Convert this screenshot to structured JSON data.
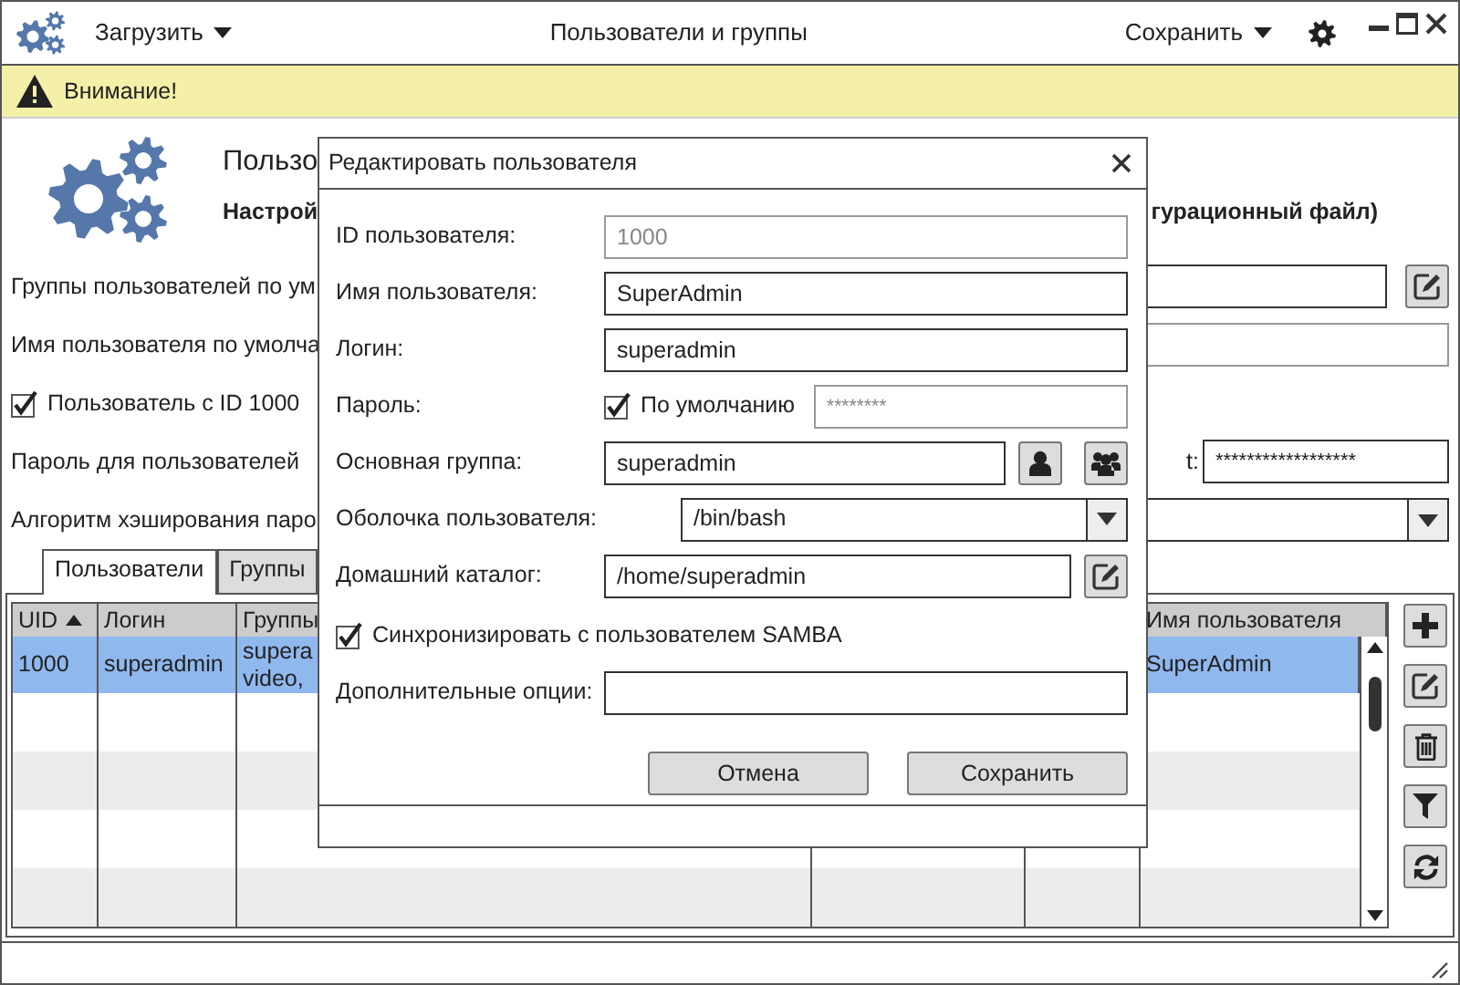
{
  "title_bar": {
    "load_menu": "Загрузить",
    "title": "Пользователи и группы",
    "save_menu": "Сохранить"
  },
  "alert": {
    "text": "Внимание!"
  },
  "header": {
    "heading": "Пользо",
    "subheading_left": "Настрой",
    "subheading_right": "гурационный файл)"
  },
  "settings": [
    {
      "kind": "field_button",
      "label": "Группы пользователей по ум",
      "disabled": false
    },
    {
      "kind": "field",
      "label": "Имя пользователя по умолча",
      "disabled": true
    },
    {
      "kind": "checkbox",
      "label": "Пользователь с ID 1000",
      "checked": true
    },
    {
      "kind": "password",
      "label": "Пароль для пользователей",
      "right_label": "t:",
      "value": "******************"
    },
    {
      "kind": "select",
      "label": "Алгоритм хэширования паро"
    }
  ],
  "tabs": [
    {
      "label": "Пользователи",
      "selected": true
    },
    {
      "label": "Группы",
      "selected": false
    }
  ],
  "table": {
    "columns": [
      {
        "label": "UID",
        "sorted": true
      },
      {
        "label": "Логин",
        "sorted": false
      },
      {
        "label": "Группы",
        "sorted": false
      },
      {
        "label": "Имя пользователя",
        "sorted": false
      }
    ],
    "rows": [
      {
        "selected": true,
        "uid": "1000",
        "login": "superadmin",
        "groups": [
          "supera",
          "video,"
        ],
        "full_name": "SuperAdmin"
      }
    ]
  },
  "dialog": {
    "title": "Редактировать пользователя",
    "fields": [
      {
        "kind": "text",
        "label": "ID пользователя:",
        "value": "1000",
        "disabled": true
      },
      {
        "kind": "text",
        "label": "Имя пользователя:",
        "value": "SuperAdmin",
        "disabled": false
      },
      {
        "kind": "text",
        "label": "Логин:",
        "value": "superadmin",
        "disabled": false
      },
      {
        "kind": "password",
        "label": "Пароль:",
        "checkbox_label": "По умолчанию",
        "checked": true,
        "value": "********",
        "disabled": true
      },
      {
        "kind": "group",
        "label": "Основная группа:",
        "value": "superadmin"
      },
      {
        "kind": "select",
        "label": "Оболочка пользователя:",
        "value": "/bin/bash"
      },
      {
        "kind": "path",
        "label": "Домашний каталог:",
        "value": "/home/superadmin"
      },
      {
        "kind": "checkbox",
        "label": "Синхронизировать с пользователем SAMBA",
        "checked": true
      },
      {
        "kind": "text",
        "label": "Дополнительные опции:",
        "disabled": false
      }
    ],
    "buttons": [
      "Отмена",
      "Сохранить"
    ]
  }
}
